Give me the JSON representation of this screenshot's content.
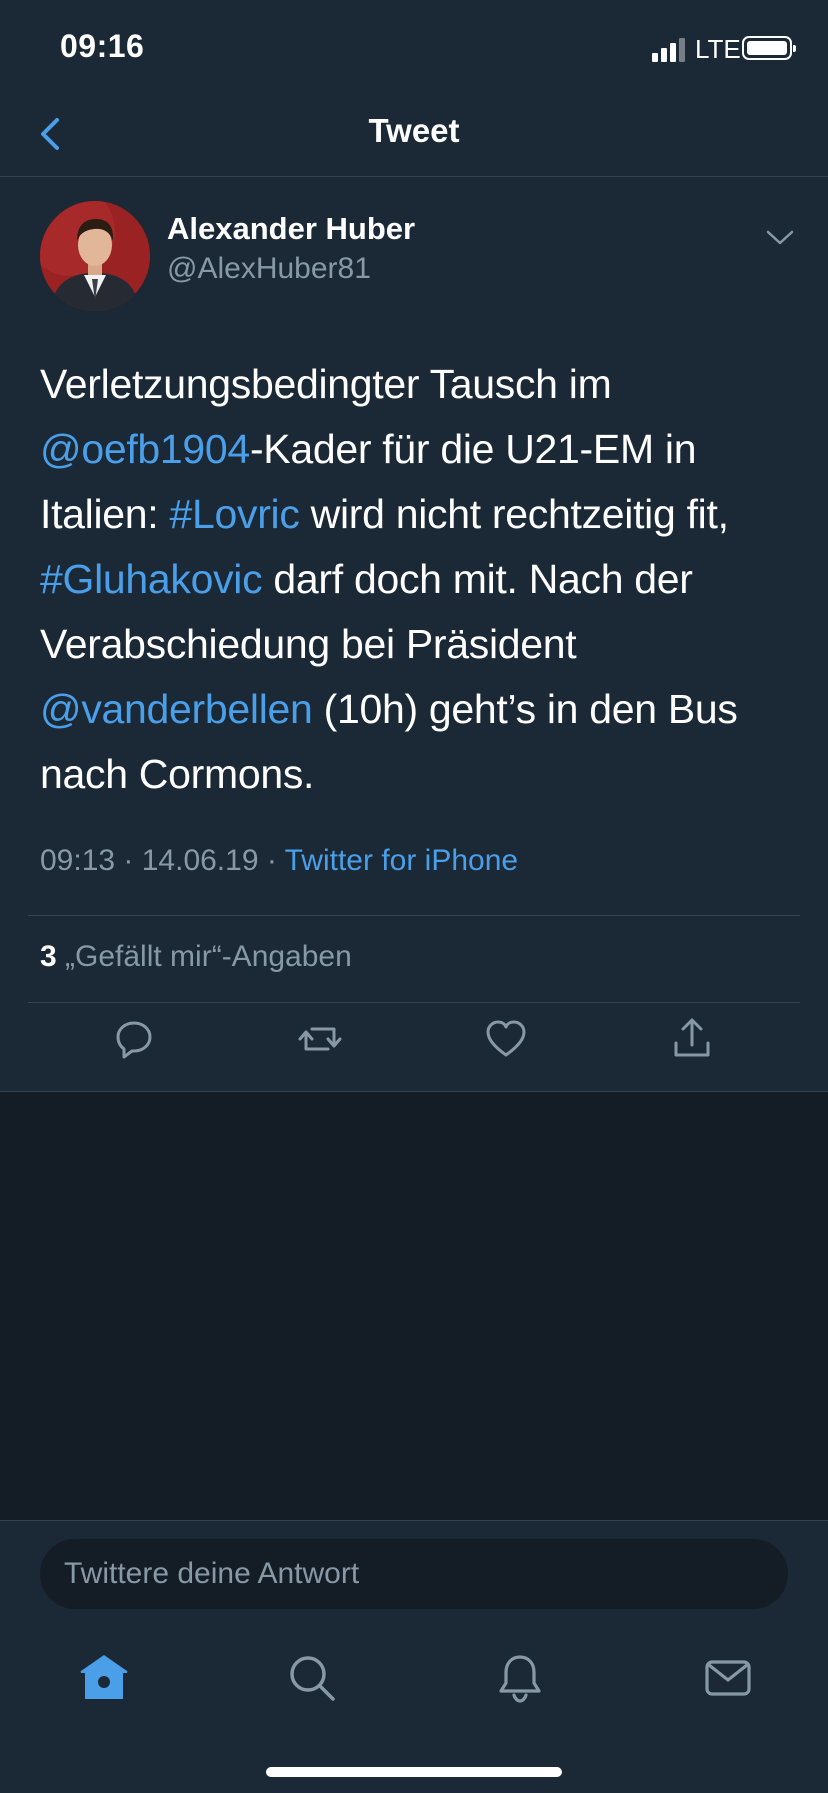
{
  "status_bar": {
    "time": "09:16",
    "network": "LTE"
  },
  "nav": {
    "title": "Tweet"
  },
  "tweet": {
    "author_name": "Alexander Huber",
    "author_handle": "@AlexHuber81",
    "text_segments": [
      {
        "text": "Verletzungsbedingter Tausch im ",
        "link": false
      },
      {
        "text": "@oefb1904",
        "link": true
      },
      {
        "text": "-Kader für die U21-EM in Italien: ",
        "link": false
      },
      {
        "text": "#Lovric",
        "link": true
      },
      {
        "text": " wird nicht rechtzeitig fit, ",
        "link": false
      },
      {
        "text": "#Gluhakovic",
        "link": true
      },
      {
        "text": " darf doch mit. Nach der Verabschiedung bei Präsident ",
        "link": false
      },
      {
        "text": "@vanderbellen",
        "link": true
      },
      {
        "text": " (10h) geht’s in den Bus nach Cormons.",
        "link": false
      }
    ],
    "timestamp": "09:13 · 14.06.19 · ",
    "source": "Twitter for iPhone",
    "likes_count": "3",
    "likes_label": " „Gefällt mir“-Angaben"
  },
  "reply": {
    "placeholder": "Twittere deine Antwort"
  },
  "icons": {
    "actions": [
      "reply-icon",
      "retweet-icon",
      "like-icon",
      "share-icon"
    ],
    "tabs": [
      "home-icon",
      "search-icon",
      "notifications-icon",
      "messages-icon"
    ]
  },
  "colors": {
    "background": "#141d26",
    "surface": "#1b2836",
    "accent": "#4a9fe8",
    "secondary_text": "#8899a6",
    "divider": "#38444d"
  }
}
